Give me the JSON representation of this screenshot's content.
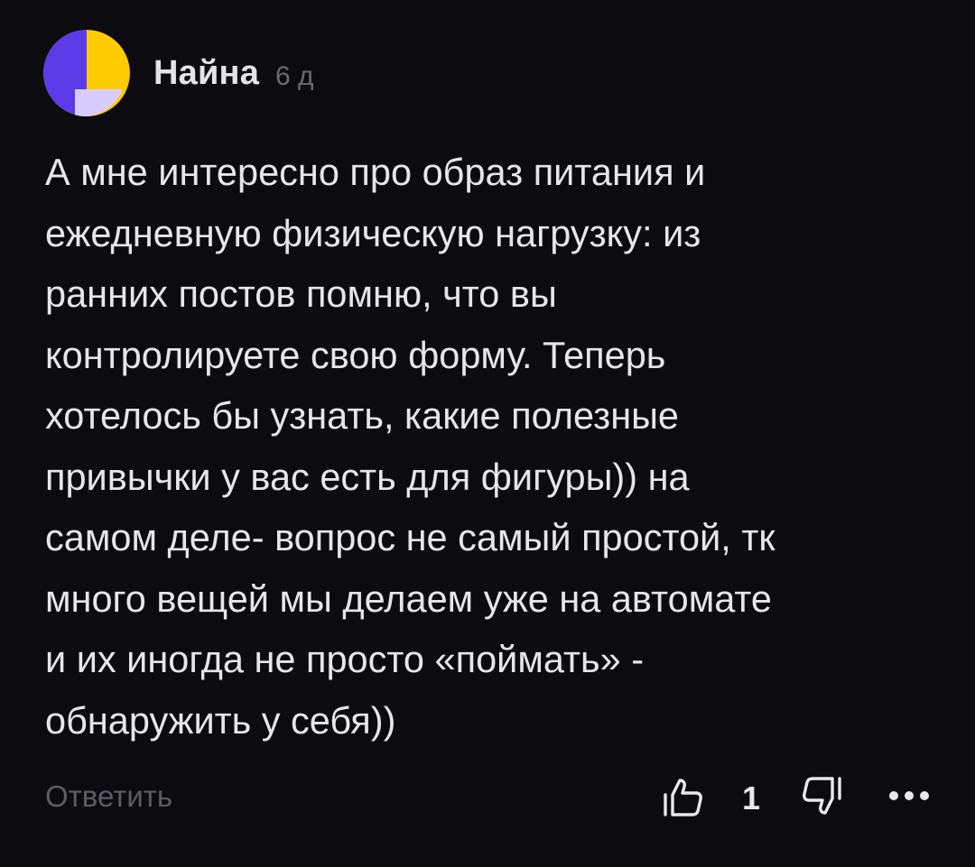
{
  "comment": {
    "author": "Найна",
    "time": "6 д",
    "text": "А мне интересно про образ питания и\nежедневную физическую нагрузку: из\nранних постов помню, что вы\nконтролируете свою форму. Теперь\nхотелось бы узнать, какие полезные\nпривычки у вас есть для фигуры)) на\nсамом деле- вопрос не самый простой, тк\nмного вещей мы делаем уже на автомате\nи их иногда не просто «поймать» -\nобнаружить у себя))",
    "reply_label": "Ответить",
    "likes": "1"
  },
  "icons": {
    "avatar": "avatar-yellow-purple",
    "like": "thumb-up-outline-icon",
    "dislike": "thumb-down-outline-icon",
    "more": "more-dots-icon"
  },
  "colors": {
    "background": "#0c0c10",
    "text": "#e6e6ea",
    "muted": "#5c5c64",
    "avatar_yellow": "#ffcc00",
    "avatar_purple": "#5b3be8",
    "avatar_lavender": "#d8ccff"
  }
}
